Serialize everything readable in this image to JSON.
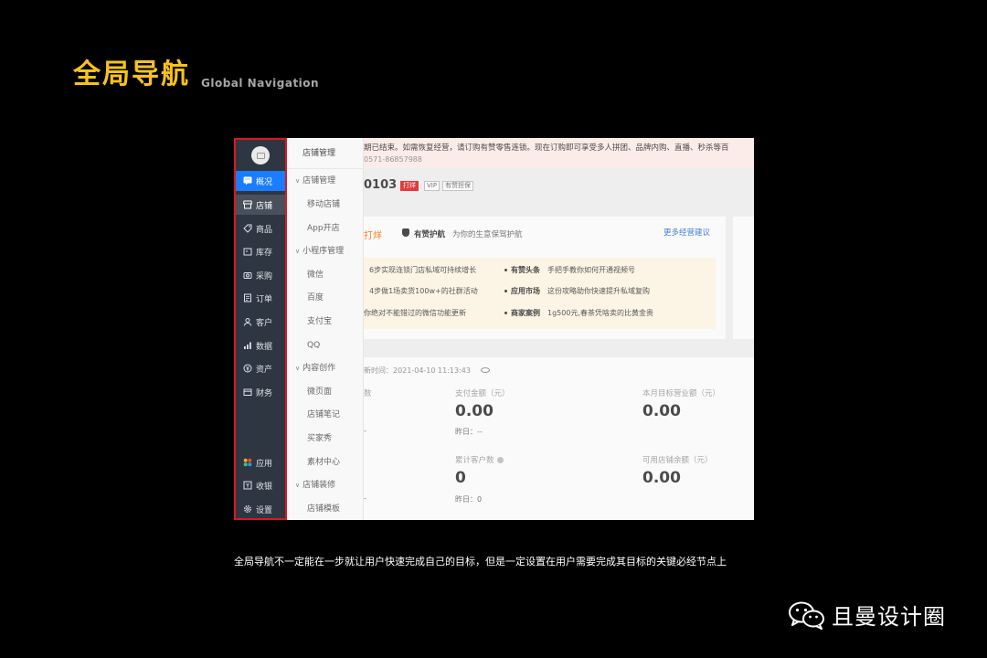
{
  "slide": {
    "title_cn": "全局导航",
    "title_en": "Global Navigation",
    "caption": "全局导航不一定能在一步就让用户快速完成自己的目标，但是一定设置在用户需要完成其目标的关键必经节点上",
    "brand": "且曼设计圈"
  },
  "main_nav": {
    "items": [
      {
        "label": "概况",
        "icon": "chat-icon"
      },
      {
        "label": "店铺",
        "icon": "store-icon"
      },
      {
        "label": "商品",
        "icon": "tag-icon"
      },
      {
        "label": "库存",
        "icon": "box-icon"
      },
      {
        "label": "采购",
        "icon": "camera-icon"
      },
      {
        "label": "订单",
        "icon": "list-icon"
      },
      {
        "label": "客户",
        "icon": "user-icon"
      },
      {
        "label": "数据",
        "icon": "bar-chart-icon"
      },
      {
        "label": "资产",
        "icon": "yen-icon"
      },
      {
        "label": "财务",
        "icon": "card-icon"
      }
    ],
    "bottom_items": [
      {
        "label": "应用",
        "icon": "apps-icon"
      },
      {
        "label": "收银",
        "icon": "cashier-icon"
      },
      {
        "label": "设置",
        "icon": "gear-icon"
      }
    ],
    "active_color": "#1a7dff",
    "highlight_color": "#e0161d"
  },
  "sub_nav": {
    "header": "店铺管理",
    "items": [
      {
        "label": "店铺管理",
        "type": "group"
      },
      {
        "label": "移动店铺",
        "type": "leaf"
      },
      {
        "label": "App开店",
        "type": "leaf"
      },
      {
        "label": "小程序管理",
        "type": "group"
      },
      {
        "label": "微信",
        "type": "leaf"
      },
      {
        "label": "百度",
        "type": "leaf"
      },
      {
        "label": "支付宝",
        "type": "leaf"
      },
      {
        "label": "QQ",
        "type": "leaf"
      },
      {
        "label": "内容创作",
        "type": "group"
      },
      {
        "label": "微页面",
        "type": "leaf"
      },
      {
        "label": "店铺笔记",
        "type": "leaf"
      },
      {
        "label": "买家秀",
        "type": "leaf"
      },
      {
        "label": "素材中心",
        "type": "leaf"
      },
      {
        "label": "店铺装修",
        "type": "group"
      },
      {
        "label": "店铺模板",
        "type": "leaf"
      }
    ]
  },
  "content": {
    "notice_line1": "期已结束。如需恢复经营，请订购有赞零售连锁。现在订购即可享受多人拼团、品牌内购、直播、秒杀等百",
    "notice_line2": "0571-86857988",
    "store_id": "0103",
    "badges": [
      "打烊",
      "VIP",
      "有赞担保"
    ],
    "card_title": "打烊",
    "guard_title": "有赞护航",
    "guard_desc": "为你的生意保驾护航",
    "more_link": "更多经营建议",
    "tips_left": [
      "6步实现连锁门店私域可持续增长",
      "4步做1场卖货100w+的社群活动",
      "你绝对不能错过的微信功能更新"
    ],
    "tips_right": [
      {
        "tag": "有赞头条",
        "text": "手把手教你如何开通视频号"
      },
      {
        "tag": "应用市场",
        "text": "这份攻略助你快速提升私域复购"
      },
      {
        "tag": "商家案例",
        "text": "1g500元,春茶凭啥卖的比黄金贵"
      }
    ],
    "update_time": "新时间：2021-04-10 11:13:43",
    "stats": {
      "col1_label": "数",
      "col1_sub1": "-",
      "col1_sub2": "-",
      "pay_label": "支付金额（元）",
      "pay_value": "0.00",
      "pay_yesterday": "昨日：--",
      "target_label": "本月目标营业额（元）",
      "target_value": "0.00",
      "customers_label": "累计客户数",
      "customers_value": "0",
      "customers_yesterday": "昨日：0",
      "balance_label": "可用店铺余额（元）",
      "balance_value": "0.00"
    }
  }
}
